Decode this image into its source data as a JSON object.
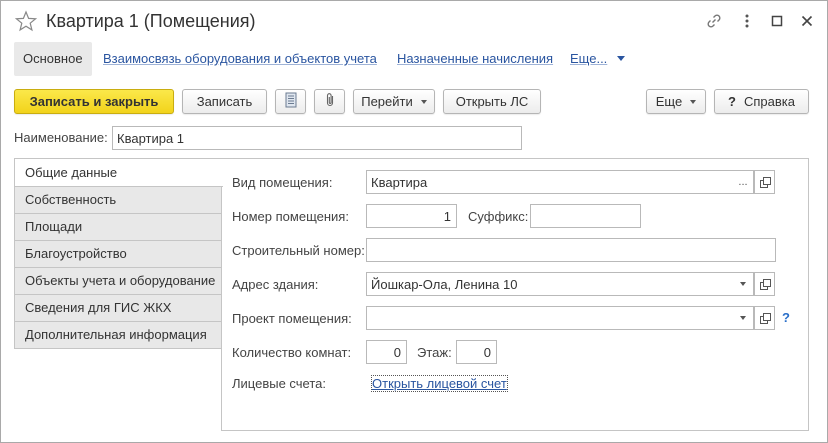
{
  "window": {
    "title": "Квартира 1 (Помещения)",
    "icons": [
      "star-icon",
      "link-icon",
      "more-vertical-icon",
      "maximize-icon",
      "close-icon"
    ]
  },
  "nav": {
    "tabs": [
      {
        "label": "Основное",
        "active": true
      },
      {
        "label": "Взаимосвязь оборудования и объектов учета",
        "active": false
      },
      {
        "label": "Назначенные начисления",
        "active": false
      }
    ],
    "more_label": "Еще..."
  },
  "toolbar": {
    "save_close_label": "Записать и закрыть",
    "save_label": "Записать",
    "report_icon": "document-icon",
    "attach_icon": "paperclip-icon",
    "goto_label": "Перейти",
    "open_account_label": "Открыть ЛС",
    "more_label": "Еще",
    "help_label": "Справка",
    "help_symbol": "?"
  },
  "name_field": {
    "label": "Наименование:",
    "value": "Квартира 1"
  },
  "side_tabs": [
    {
      "label": "Общие данные",
      "active": true
    },
    {
      "label": "Собственность",
      "active": false
    },
    {
      "label": "Площади",
      "active": false
    },
    {
      "label": "Благоустройство",
      "active": false
    },
    {
      "label": "Объекты учета и оборудование",
      "active": false
    },
    {
      "label": "Сведения для ГИС ЖКХ",
      "active": false
    },
    {
      "label": "Дополнительная информация",
      "active": false
    }
  ],
  "form": {
    "room_type": {
      "label": "Вид помещения:",
      "value": "Квартира",
      "select_symbol": "..."
    },
    "room_number": {
      "label": "Номер помещения:",
      "value": "1"
    },
    "suffix": {
      "label": "Суффикс:",
      "value": ""
    },
    "build_number": {
      "label": "Строительный номер:",
      "value": ""
    },
    "address": {
      "label": "Адрес здания:",
      "value": "Йошкар-Ола, Ленина 10"
    },
    "project": {
      "label": "Проект помещения:",
      "value": "",
      "help_symbol": "?"
    },
    "rooms_count": {
      "label": "Количество комнат:",
      "value": "0"
    },
    "floor": {
      "label": "Этаж:",
      "value": "0"
    },
    "accounts": {
      "label": "Лицевые счета:",
      "link": "Открыть лицевой счет"
    }
  }
}
